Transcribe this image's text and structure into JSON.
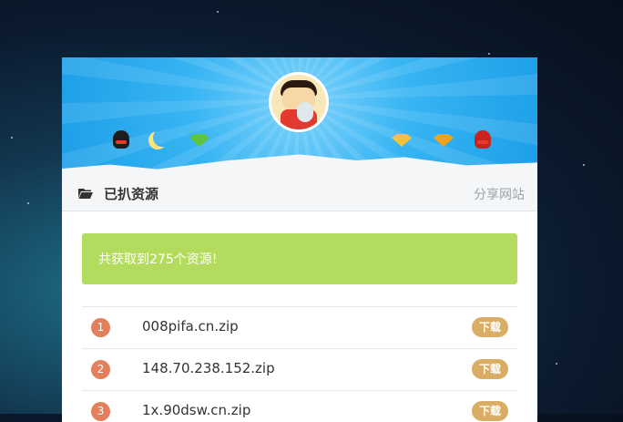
{
  "header": {
    "title": "已扒资源",
    "share_link": "分享网站",
    "folder_icon": "folder-open-icon"
  },
  "banner": {
    "avatar_icon": "cartoon-avatar",
    "left_decorations": [
      "qq-penguin-icon",
      "moon-icon",
      "green-diamond-icon"
    ],
    "right_decorations": [
      "yellow-diamond-icon",
      "thunder-diamond-icon",
      "qq-penguin-icon"
    ],
    "colors": {
      "sky": "#2fb0f0",
      "snow": "#f4f6f8"
    }
  },
  "alert": {
    "message": "共获取到275个资源!",
    "color": "#b3dc5e"
  },
  "files": [
    {
      "index": "1",
      "name": "008pifa.cn.zip",
      "action": "下载"
    },
    {
      "index": "2",
      "name": "148.70.238.152.zip",
      "action": "下载"
    },
    {
      "index": "3",
      "name": "1x.90dsw.cn.zip",
      "action": "下载"
    }
  ],
  "colors": {
    "badge": "#e47f5d",
    "download_button": "#d9ad63"
  }
}
